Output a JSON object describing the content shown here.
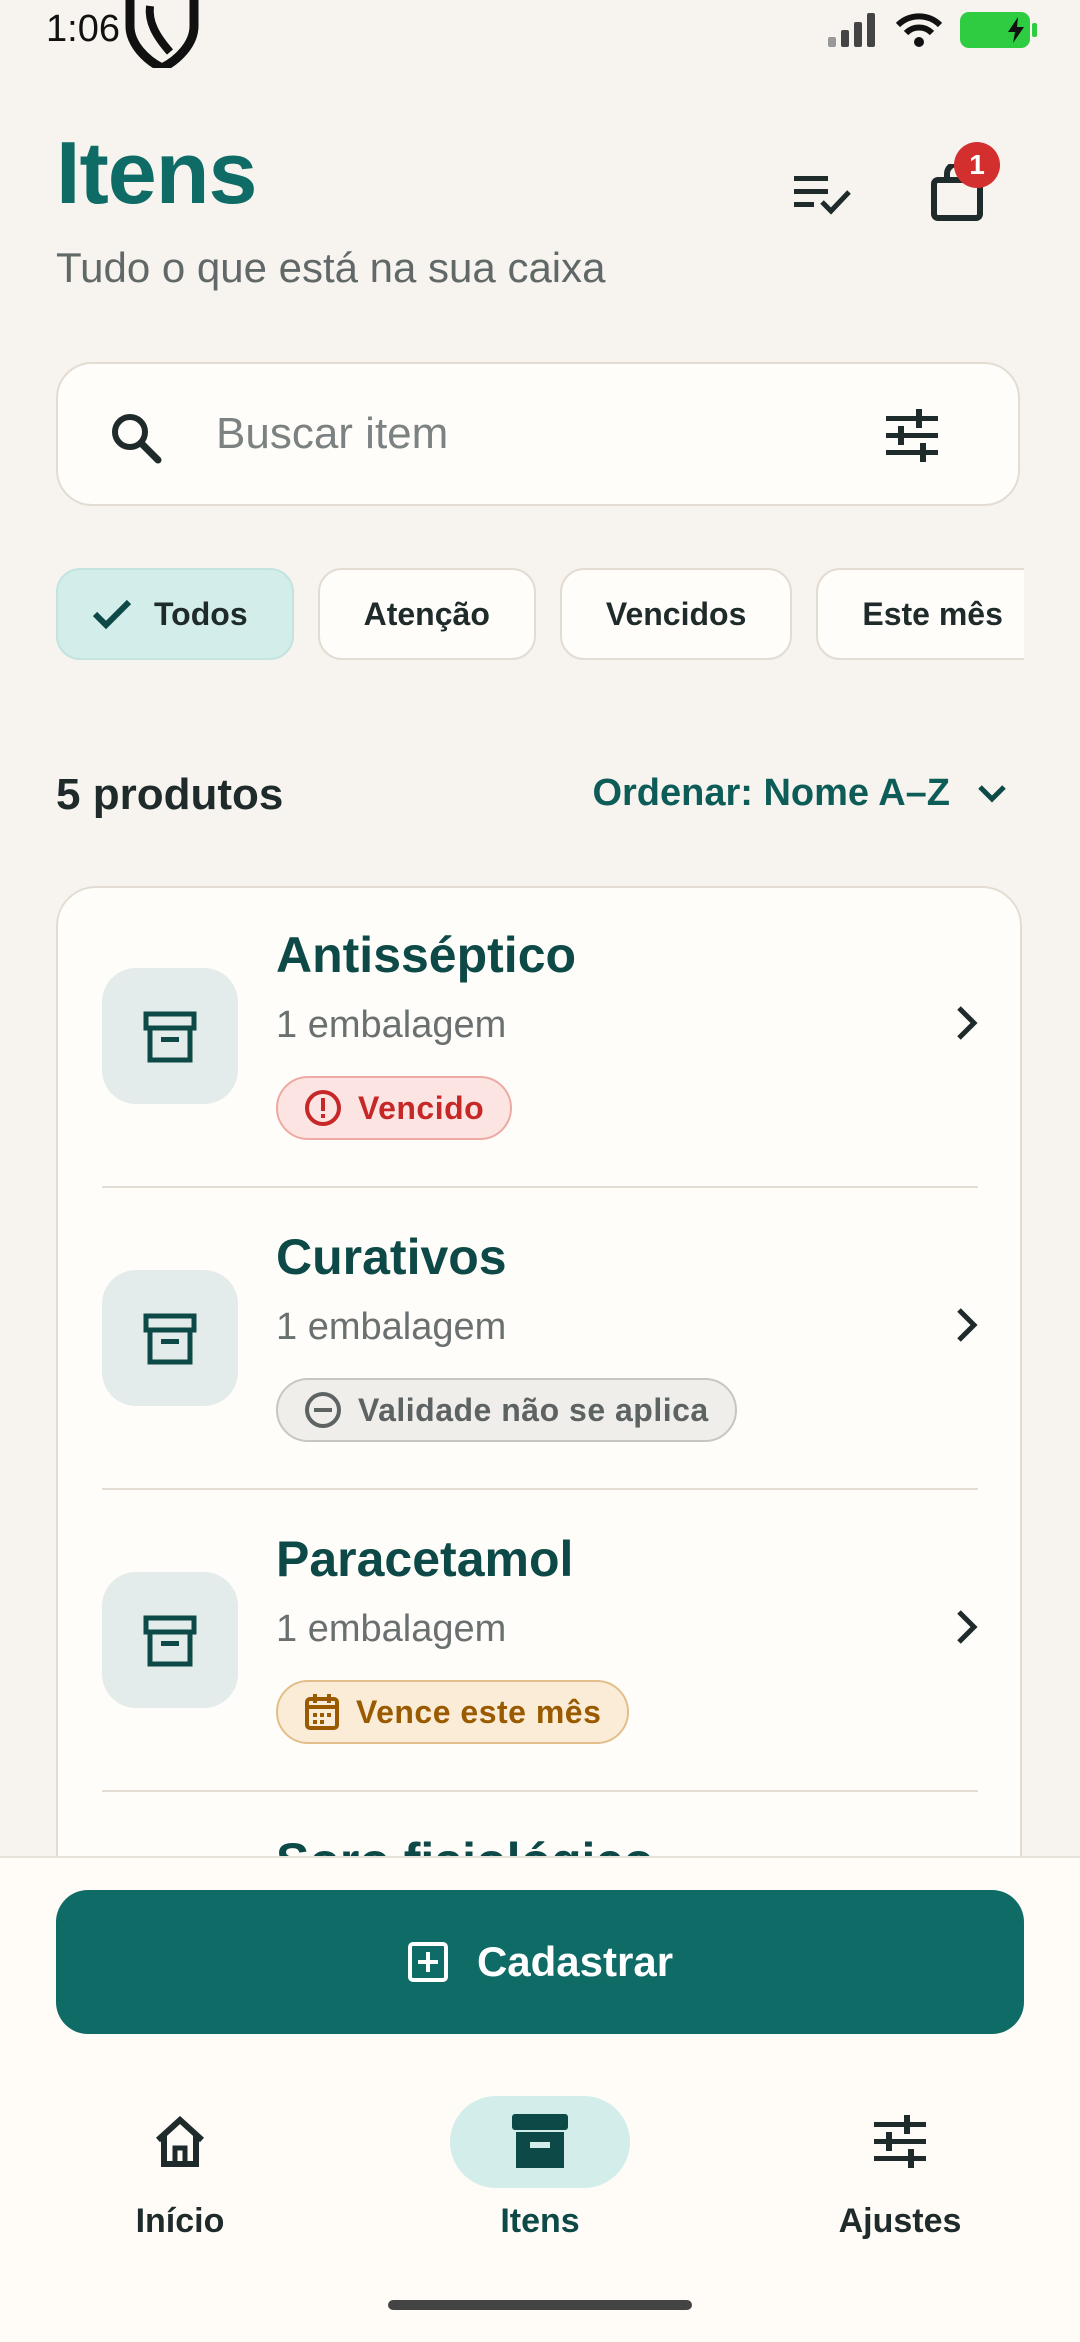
{
  "status": {
    "time": "1:06"
  },
  "header": {
    "title": "Itens",
    "subtitle": "Tudo o que está na sua caixa",
    "bag_count": "1"
  },
  "search": {
    "placeholder": "Buscar item",
    "value": ""
  },
  "filters": [
    {
      "label": "Todos",
      "active": true
    },
    {
      "label": "Atenção",
      "active": false
    },
    {
      "label": "Vencidos",
      "active": false
    },
    {
      "label": "Este mês",
      "active": false
    }
  ],
  "list": {
    "count_label": "5 produtos",
    "sort_label": "Ordenar: Nome A–Z",
    "items": [
      {
        "name": "Antisséptico",
        "meta": "1 embalagem",
        "status": "Vencido",
        "status_icon": "alert-circle-icon"
      },
      {
        "name": "Curativos",
        "meta": "1 embalagem",
        "status": "Validade não se aplica",
        "status_icon": "minus-circle-icon"
      },
      {
        "name": "Paracetamol",
        "meta": "1 embalagem",
        "status": "Vence este mês",
        "status_icon": "calendar-icon"
      },
      {
        "name": "Soro fisiológico",
        "meta": "",
        "status": "",
        "status_icon": ""
      }
    ]
  },
  "cta": {
    "label": "Cadastrar"
  },
  "bottom_nav": [
    {
      "label": "Início",
      "icon": "home-icon",
      "active": false
    },
    {
      "label": "Itens",
      "icon": "archive-icon",
      "active": true
    },
    {
      "label": "Ajustes",
      "icon": "sliders-icon",
      "active": false
    }
  ],
  "colors": {
    "brand": "#0f6b66",
    "background": "#f7f4ef",
    "chip_active": "#d3eeea",
    "badge_red": "#c62828",
    "badge_amber": "#9a5a00",
    "badge_red_dot": "#d32f2f"
  }
}
